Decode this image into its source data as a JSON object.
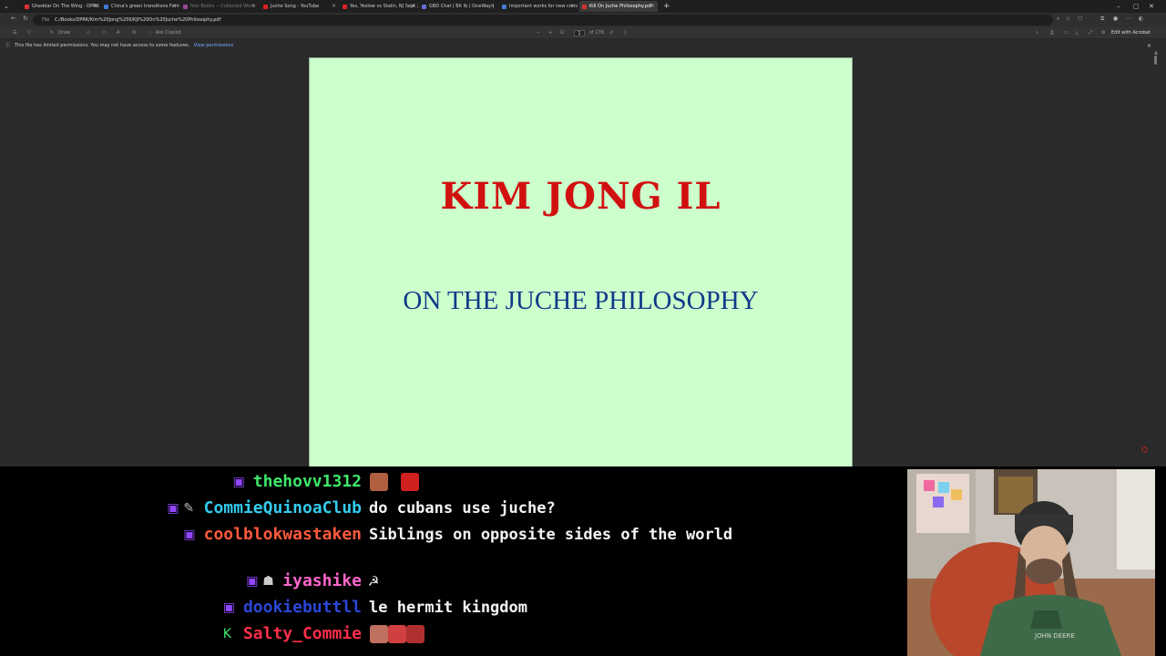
{
  "browser": {
    "tabs": [
      {
        "label": "Gheddar On The Wing - DPRK ln",
        "fav": "#e03030",
        "state": "normal"
      },
      {
        "label": "China's green transitions Form Yo",
        "fav": "#3b7bd8",
        "state": "normal"
      },
      {
        "label": "Nov Books -- Collected Work",
        "fav": "#9a4a9a",
        "state": "dim"
      },
      {
        "label": "Juche Song - YouTube",
        "fav": "#e02020",
        "state": "normal"
      },
      {
        "label": "Yes, Yeslow vs Stalin, NJ Sept 20",
        "fav": "#e02020",
        "state": "normal"
      },
      {
        "label": "GBD Chat | Bit Ib | OneWay |",
        "fav": "#6b6bd8",
        "state": "normal"
      },
      {
        "label": "Important works for new commu",
        "fav": "#4a7ad8",
        "state": "normal"
      },
      {
        "label": "Kill On Juche Philosophy.pdf",
        "fav": "#d83030",
        "state": "active"
      }
    ],
    "url_scheme": "File",
    "url": "C:/Books/DPRK/Kim%20Jong%20Il/KJI%20On%20Juche%20Philosophy.pdf",
    "toolbar": {
      "draw_label": "Draw",
      "ask_copilot_label": "Ask Copilot",
      "zoom_out": "−",
      "zoom_in": "+",
      "page_current": "1",
      "page_total": "of 178",
      "edit_acrobat_label": "Edit with Acrobat"
    },
    "notice": {
      "text": "This file has limited permissions. You may not have access to some features.",
      "link": "View permissions"
    }
  },
  "pdf": {
    "author": "KIM JONG IL",
    "title": "ON THE JUCHE PHILOSOPHY",
    "page_color": "#ccffcc",
    "author_color": "#d11010",
    "title_color": "#103a8a"
  },
  "chat": {
    "messages": [
      {
        "user": "thehovv1312",
        "color": "#3ee86a",
        "text": "",
        "badges": [
          "twitch"
        ]
      },
      {
        "user": "CommieQuinoaClub",
        "color": "#33ccee",
        "text": "do cubans use juche?",
        "badges": [
          "twitch",
          "pen"
        ]
      },
      {
        "user": "coolblokwastaken",
        "color": "#ff5a3c",
        "text": "Siblings on opposite sides of the world",
        "badges": [
          "twitch"
        ]
      },
      {
        "user": "iyashike",
        "color": "#ff66cc",
        "text": "☭",
        "badges": [
          "twitch",
          "robot"
        ]
      },
      {
        "user": "dookiebuttll",
        "color": "#2b46d8",
        "text": "le hermit kingdom",
        "badges": [
          "twitch"
        ]
      },
      {
        "user": "Salty_Commie",
        "color": "#ff2e4a",
        "text": "",
        "badges": [
          "k"
        ]
      }
    ]
  }
}
